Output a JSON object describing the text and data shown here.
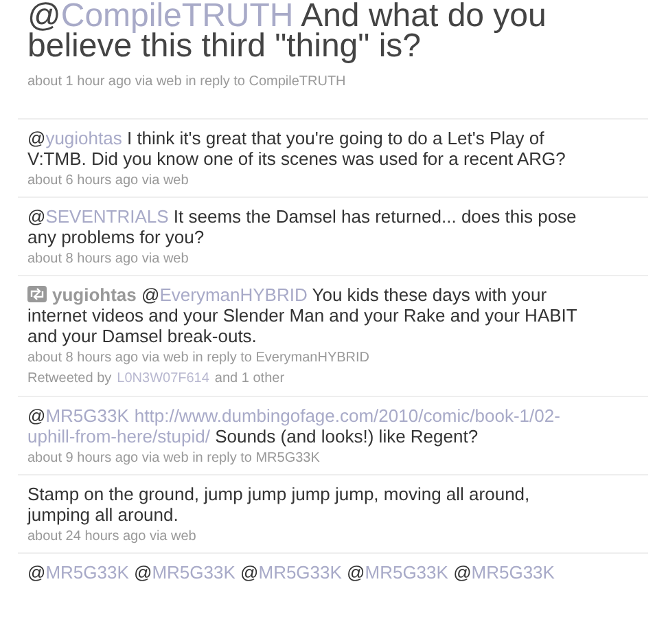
{
  "tweets": [
    {
      "kind": "headline",
      "text": [
        {
          "kind": "text",
          "s": "@"
        },
        {
          "kind": "mention",
          "s": "CompileTRUTH"
        },
        {
          "kind": "text",
          "s": " And what do you believe this third \"thing\" is?"
        }
      ],
      "meta": "about 1 hour ago via web in reply to CompileTRUTH"
    },
    {
      "kind": "tweet",
      "text": [
        {
          "kind": "text",
          "s": "@"
        },
        {
          "kind": "mention",
          "s": "yugiohtas"
        },
        {
          "kind": "text",
          "s": " I think it's great that you're going to do a Let's Play of V:TMB. Did you know one of its scenes was used for a recent ARG?"
        }
      ],
      "meta": "about 6 hours ago via web"
    },
    {
      "kind": "tweet",
      "text": [
        {
          "kind": "text",
          "s": "@"
        },
        {
          "kind": "mention",
          "s": "SEVENTRIALS"
        },
        {
          "kind": "text",
          "s": " It seems the Damsel has returned... does this pose any problems for you?"
        }
      ],
      "meta": "about 8 hours ago via web"
    },
    {
      "kind": "tweet",
      "retweet": true,
      "text": [
        {
          "kind": "author",
          "s": "yugiohtas"
        },
        {
          "kind": "text",
          "s": " @"
        },
        {
          "kind": "mention",
          "s": "EverymanHYBRID"
        },
        {
          "kind": "text",
          "s": " You kids these days with your internet videos and your Slender Man and your Rake and your HABIT and your Damsel break-outs."
        }
      ],
      "meta": "about 8 hours ago via web in reply to EverymanHYBRID",
      "retweeted_by": [
        {
          "kind": "text",
          "s": "Retweeted by"
        },
        {
          "kind": "link",
          "s": "L0N3W07F614"
        },
        {
          "kind": "text",
          "s": "and 1 other"
        }
      ]
    },
    {
      "kind": "tweet",
      "text": [
        {
          "kind": "text",
          "s": "@"
        },
        {
          "kind": "mention",
          "s": "MR5G33K"
        },
        {
          "kind": "url",
          "s": "http://www.dumbingofage.com/2010/comic/book-1/02-"
        },
        {
          "kind": "url",
          "s": "uphill-from-here/stupid/"
        },
        {
          "kind": "text",
          "s": " Sounds (and looks!) like Regent?"
        }
      ],
      "meta": "about 9 hours ago via web in reply to MR5G33K"
    },
    {
      "kind": "tweet",
      "text": [
        {
          "kind": "text",
          "s": "Stamp on the ground, jump jump jump jump, moving all around, jumping all around."
        }
      ],
      "meta": "about 24 hours ago via web"
    },
    {
      "kind": "tweet",
      "text": [
        {
          "kind": "text",
          "s": "@"
        },
        {
          "kind": "mention",
          "s": "MR5G33K"
        },
        {
          "kind": "text",
          "s": " @"
        },
        {
          "kind": "mention",
          "s": "MR5G33K"
        },
        {
          "kind": "text",
          "s": " @"
        },
        {
          "kind": "mention",
          "s": "MR5G33K"
        },
        {
          "kind": "text",
          "s": " @"
        },
        {
          "kind": "mention",
          "s": "MR5G33K"
        },
        {
          "kind": "text",
          "s": " @"
        },
        {
          "kind": "mention",
          "s": "MR5G33K"
        }
      ]
    }
  ]
}
